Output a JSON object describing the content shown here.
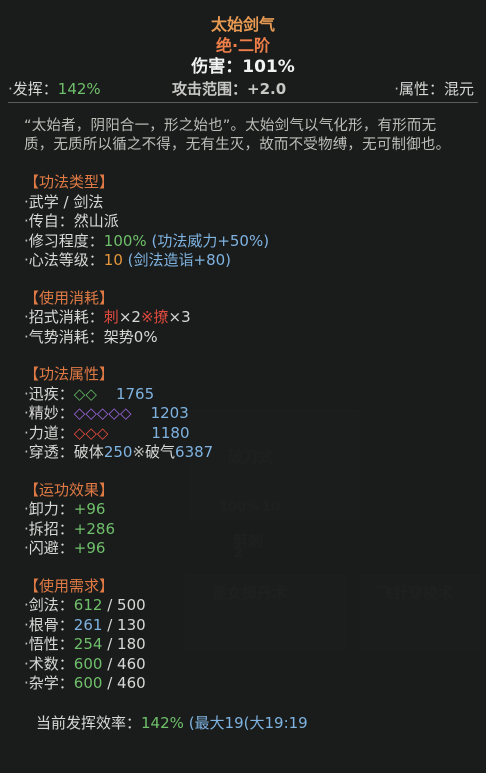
{
  "skill": {
    "name": "太始剑气",
    "rank": "绝·二阶",
    "damage_label": "伤害：",
    "damage_value": "101%"
  },
  "stats": {
    "fahui_label": "发挥：",
    "fahui_value": "142%",
    "range_label": "攻击范围：",
    "range_value": "+2.0",
    "attr_label": "属性：",
    "attr_value": "混元"
  },
  "description": "“太始者，阴阳合一，形之始也”。太始剑气以气化形，有形而无质，无质所以循之不得，无有生灭，故而不受物缚，无可制御也。",
  "type_section": {
    "title": "【功法类型】",
    "category": "武学 / 剑法",
    "source_label": "传自：",
    "source_value": "然山派",
    "practice_label": "修习程度：",
    "practice_value": "100%",
    "practice_extra": "(功法威力+50%)",
    "heart_label": "心法等级：",
    "heart_value": "10",
    "heart_extra": "(剑法造诣+80)"
  },
  "cost_section": {
    "title": "【使用消耗】",
    "moves_label": "招式消耗：",
    "move1": "刺",
    "move1_count": "×2",
    "sep": "※",
    "move2": "撩",
    "move2_count": "×3",
    "momentum_label": "气势消耗：",
    "momentum_value": "架势0%"
  },
  "attr_section": {
    "title": "【功法属性】",
    "speed_label": "迅疾：",
    "speed_diamonds": "◇◇",
    "speed_value": "1765",
    "finesse_label": "精妙：",
    "finesse_diamonds": "◇◇◇◇◇",
    "finesse_value": "1203",
    "power_label": "力道：",
    "power_diamonds": "◇◇◇",
    "power_value": "1180",
    "pierce_label": "穿透：",
    "pierce_body": "破体",
    "pierce_body_value": "250",
    "pierce_sep": "※",
    "pierce_qi": "破气",
    "pierce_qi_value": "6387"
  },
  "effect_section": {
    "title": "【运功效果】",
    "unload_label": "卸力：",
    "unload_value": "+96",
    "dismantle_label": "拆招：",
    "dismantle_value": "+286",
    "dodge_label": "闪避：",
    "dodge_value": "+96"
  },
  "req_section": {
    "title": "【使用需求】",
    "sword_label": "剑法：",
    "sword_cur": "612",
    "sword_req": " / 500",
    "bone_label": "根骨：",
    "bone_cur": "261",
    "bone_req": " / 130",
    "insight_label": "悟性：",
    "insight_cur": "254",
    "insight_req": " / 180",
    "arts_label": "术数：",
    "arts_cur": "600",
    "arts_req": " / 460",
    "misc_label": "杂学：",
    "misc_cur": "600",
    "misc_req": " / 460"
  },
  "footer": {
    "label": "当前发挥效率：",
    "value": "142%",
    "extra": "(最大19(大19:19"
  },
  "bullet": "·",
  "background_ghosts": {
    "label1": "破刀式",
    "label2": "剪刺",
    "label3": "星女掷丹术",
    "label4": "飞针穿梭术",
    "num1": "100%",
    "num2": "10",
    "num3": "2"
  }
}
